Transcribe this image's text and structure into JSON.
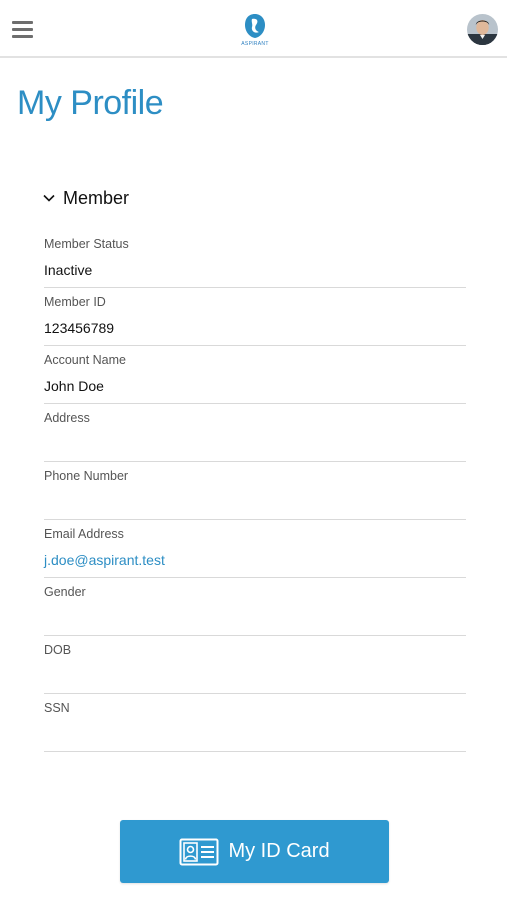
{
  "header": {
    "menu_icon": "hamburger-menu-icon",
    "logo_text": "ASPIRANT",
    "brand_color": "#2d8ec4",
    "avatar_icon": "user-avatar"
  },
  "page": {
    "title": "My Profile"
  },
  "member_section": {
    "toggle_icon": "chevron-down-icon",
    "label": "Member",
    "fields": [
      {
        "label": "Member Status",
        "value": "Inactive"
      },
      {
        "label": "Member ID",
        "value": "123456789"
      },
      {
        "label": "Account Name",
        "value": "John Doe"
      },
      {
        "label": "Address",
        "value": ""
      },
      {
        "label": "Phone Number",
        "value": ""
      },
      {
        "label": "Email Address",
        "value": "j.doe@aspirant.test"
      },
      {
        "label": "Gender",
        "value": ""
      },
      {
        "label": "DOB",
        "value": ""
      },
      {
        "label": "SSN",
        "value": ""
      }
    ]
  },
  "id_card_button": {
    "icon": "id-card-icon",
    "label": "My ID Card",
    "color": "#2f99d0"
  }
}
